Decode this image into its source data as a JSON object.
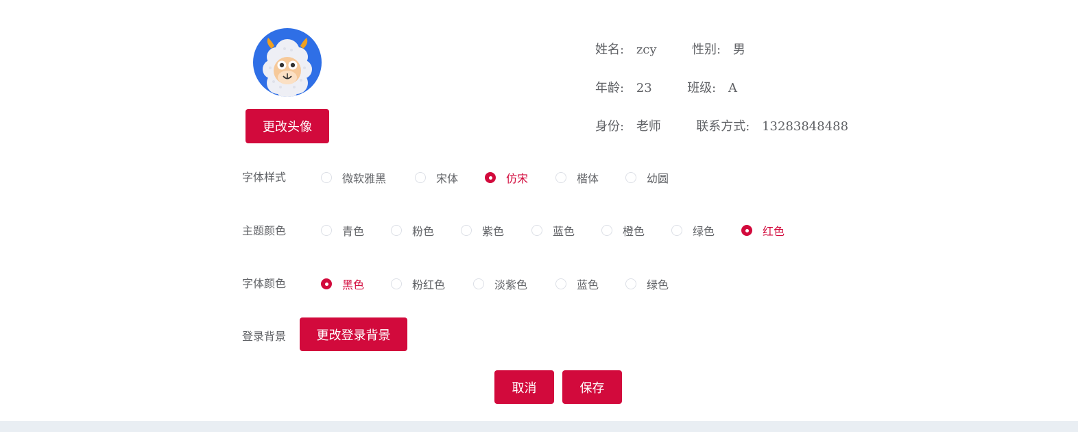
{
  "profile": {
    "avatar_alt": "sheep avatar",
    "change_avatar_button": "更改头像",
    "name_label": "姓名:",
    "name_value": "zcy",
    "gender_label": "性别:",
    "gender_value": "男",
    "age_label": "年龄:",
    "age_value": "23",
    "class_label": "班级:",
    "class_value": "A",
    "identity_label": "身份:",
    "identity_value": "老师",
    "contact_label": "联系方式:",
    "contact_value": "13283848488"
  },
  "settings": {
    "font_style": {
      "label": "字体样式",
      "options": [
        "微软雅黑",
        "宋体",
        "仿宋",
        "楷体",
        "幼圆"
      ],
      "selected": "仿宋"
    },
    "theme_color": {
      "label": "主题颜色",
      "options": [
        "青色",
        "粉色",
        "紫色",
        "蓝色",
        "橙色",
        "绿色",
        "红色"
      ],
      "selected": "红色"
    },
    "font_color": {
      "label": "字体颜色",
      "options": [
        "黑色",
        "粉红色",
        "淡紫色",
        "蓝色",
        "绿色"
      ],
      "selected": "黑色"
    },
    "login_background": {
      "label": "登录背景",
      "button": "更改登录背景"
    }
  },
  "actions": {
    "cancel": "取消",
    "save": "保存"
  },
  "colors": {
    "accent": "#d20a3c",
    "avatar_bg": "#2f6fe6",
    "text": "#606266",
    "footer": "#e9eef3"
  }
}
